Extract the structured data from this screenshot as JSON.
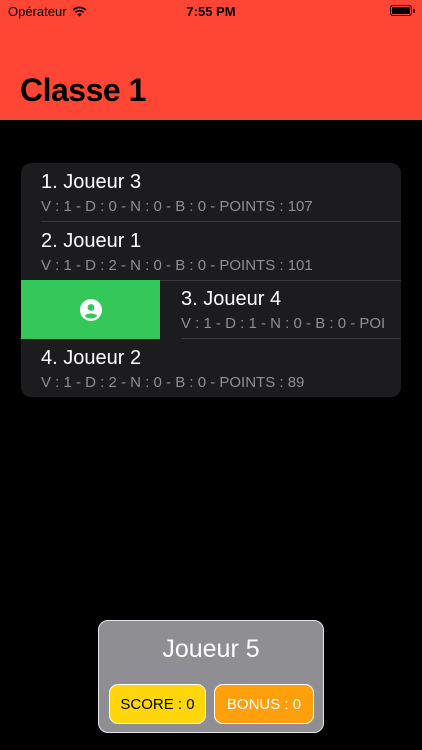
{
  "status_bar": {
    "carrier": "Opérateur",
    "time": "7:55 PM"
  },
  "header": {
    "title": "Classe 1",
    "background": "#ff4634"
  },
  "ranking": [
    {
      "name": "1. Joueur 3",
      "stats": "V : 1 - D : 0 - N : 0 - B : 0 - POINTS : 107"
    },
    {
      "name": "2. Joueur 1",
      "stats": "V : 1 - D : 2 - N : 0 - B : 0 - POINTS : 101"
    },
    {
      "name": "3. Joueur 4",
      "stats": "V : 1 - D : 1 - N : 0 - B : 0 - POI"
    },
    {
      "name": "4. Joueur 2",
      "stats": "V : 1 - D : 2 - N : 0 - B : 0 - POINTS : 89"
    }
  ],
  "swipe_action": {
    "icon": "person-circle-icon",
    "color": "#34c759"
  },
  "current_player": {
    "name": "Joueur 5",
    "score_label": "SCORE : 0",
    "bonus_label": "BONUS : 0",
    "score_color": "#ffd60a",
    "bonus_color": "#ff9f0a"
  }
}
